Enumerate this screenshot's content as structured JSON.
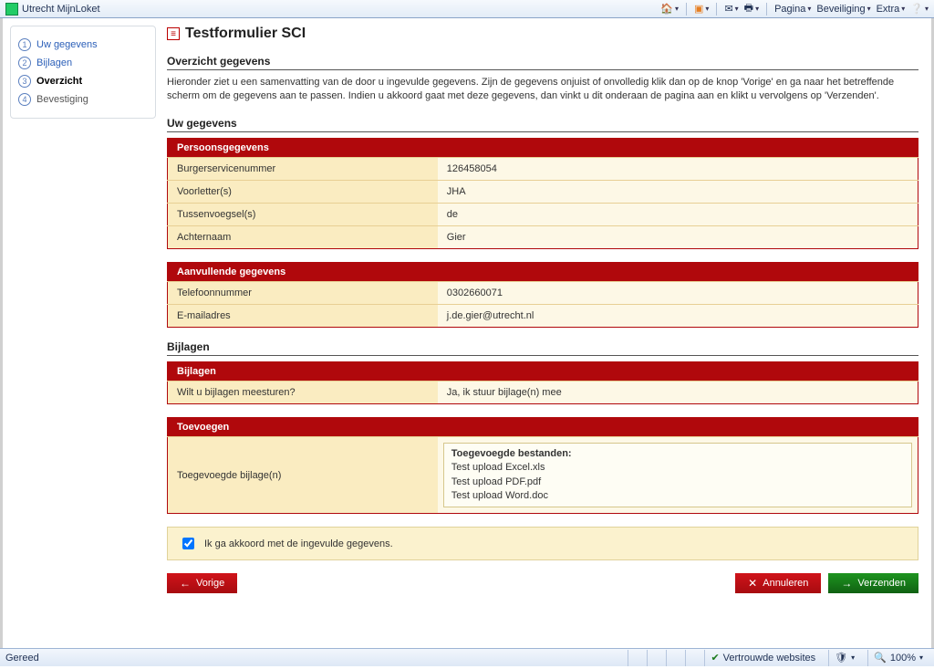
{
  "browser": {
    "tab_title": "Utrecht MijnLoket",
    "menu": {
      "home_icon": "home-icon",
      "rss_icon": "rss-icon",
      "mail_icon": "mail-icon",
      "print_icon": "print-icon",
      "page": "Pagina",
      "security": "Beveiliging",
      "extra": "Extra",
      "help_icon": "help-icon"
    }
  },
  "sidebar": {
    "items": [
      {
        "num": "1",
        "label": "Uw gegevens",
        "state": "link"
      },
      {
        "num": "2",
        "label": "Bijlagen",
        "state": "link"
      },
      {
        "num": "3",
        "label": "Overzicht",
        "state": "active"
      },
      {
        "num": "4",
        "label": "Bevestiging",
        "state": "disabled"
      }
    ]
  },
  "page": {
    "title": "Testformulier SCI",
    "overview_header": "Overzicht gegevens",
    "intro": "Hieronder ziet u een samenvatting van de door u ingevulde gegevens. Zijn de gegevens onjuist of onvolledig klik dan op de knop 'Vorige' en ga naar het betreffende scherm om de gegevens aan te passen. Indien u akkoord gaat met deze gegevens, dan vinkt u dit onderaan de pagina aan en klikt u vervolgens op 'Verzenden'.",
    "uw_gegevens_header": "Uw gegevens",
    "bijlagen_header": "Bijlagen"
  },
  "tables": {
    "persoons": {
      "title": "Persoonsgegevens",
      "rows": [
        {
          "key": "Burgerservicenummer",
          "val": "126458054"
        },
        {
          "key": "Voorletter(s)",
          "val": "JHA"
        },
        {
          "key": "Tussenvoegsel(s)",
          "val": "de"
        },
        {
          "key": "Achternaam",
          "val": "Gier"
        }
      ]
    },
    "aanvullend": {
      "title": "Aanvullende gegevens",
      "rows": [
        {
          "key": "Telefoonnummer",
          "val": "0302660071"
        },
        {
          "key": "E-mailadres",
          "val": "j.de.gier@utrecht.nl"
        }
      ]
    },
    "bijlagen": {
      "title": "Bijlagen",
      "rows": [
        {
          "key": "Wilt u bijlagen meesturen?",
          "val": "Ja, ik stuur bijlage(n) mee"
        }
      ]
    },
    "toevoegen": {
      "title": "Toevoegen",
      "key": "Toegevoegde bijlage(n)",
      "files_title": "Toegevoegde bestanden:",
      "files": [
        "Test upload Excel.xls",
        "Test upload PDF.pdf",
        "Test upload Word.doc"
      ]
    }
  },
  "agree": {
    "label": "Ik ga akkoord met de ingevulde gegevens.",
    "checked": true
  },
  "buttons": {
    "prev": "Vorige",
    "cancel": "Annuleren",
    "submit": "Verzenden"
  },
  "statusbar": {
    "status": "Gereed",
    "trusted": "Vertrouwde websites",
    "zoom": "100%"
  }
}
